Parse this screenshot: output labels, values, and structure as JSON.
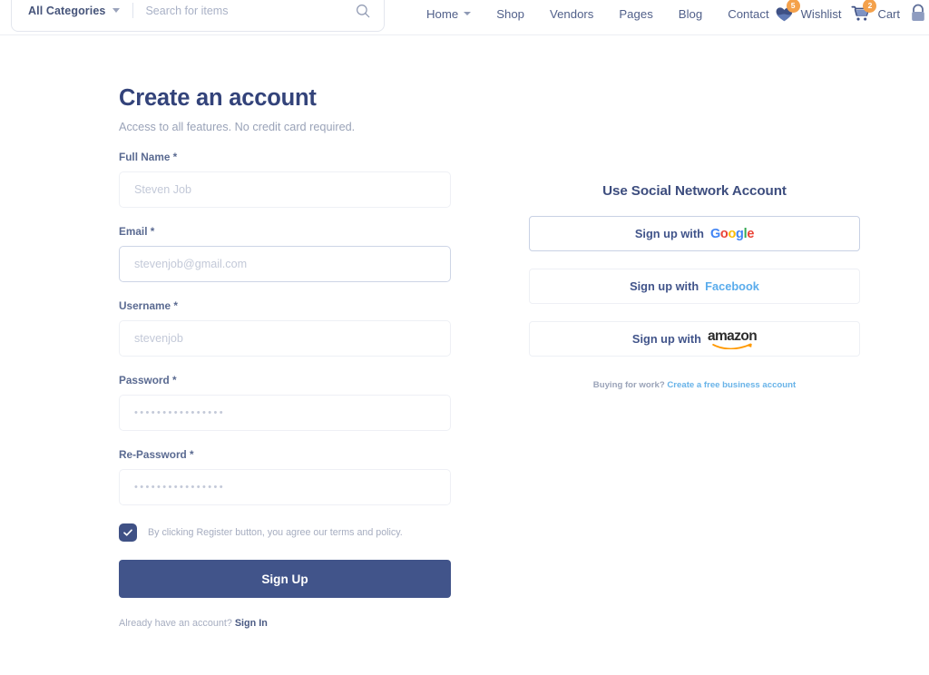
{
  "header": {
    "search": {
      "category_label": "All Categories",
      "category_icon": "chevron-down-icon",
      "placeholder": "Search for items",
      "value": "",
      "search_icon": "search-icon"
    },
    "nav": [
      {
        "label": "Home",
        "has_dropdown": true
      },
      {
        "label": "Shop",
        "has_dropdown": false
      },
      {
        "label": "Vendors",
        "has_dropdown": false
      },
      {
        "label": "Pages",
        "has_dropdown": false
      },
      {
        "label": "Blog",
        "has_dropdown": false
      },
      {
        "label": "Contact",
        "has_dropdown": false
      }
    ],
    "wishlist": {
      "label": "Wishlist",
      "badge": "5",
      "icon": "heart-icon"
    },
    "cart": {
      "label": "Cart",
      "badge": "2",
      "icon": "shopping-cart-icon"
    },
    "account": {
      "icon": "user-account-icon"
    }
  },
  "signup": {
    "title": "Create an account",
    "subtitle": "Access to all features. No credit card required.",
    "fields": [
      {
        "label": "Full Name *",
        "placeholder": "Steven Job",
        "type": "text",
        "focused": false
      },
      {
        "label": "Email *",
        "placeholder": "stevenjob@gmail.com",
        "type": "text",
        "focused": true
      },
      {
        "label": "Username *",
        "placeholder": "stevenjob",
        "type": "text",
        "focused": false
      },
      {
        "label": "Password *",
        "placeholder": "••••••••••••••••",
        "type": "password",
        "focused": false
      },
      {
        "label": "Re-Password *",
        "placeholder": "••••••••••••••••",
        "type": "password",
        "focused": false
      }
    ],
    "terms": {
      "checked": true,
      "checkbox_icon": "checkmark-icon",
      "text": "By clicking Register button, you agree our terms and policy."
    },
    "submit_label": "Sign Up",
    "signin_prefix": "Already have an account?",
    "signin_link": "Sign In"
  },
  "social": {
    "title": "Use Social Network Account",
    "buttons": [
      {
        "prefix": "Sign up with",
        "brand": "Google",
        "brand_icon": "google-logo-icon"
      },
      {
        "prefix": "Sign up with",
        "brand": "Facebook",
        "brand_icon": "facebook-wordmark-icon"
      },
      {
        "prefix": "Sign up with",
        "brand": "amazon",
        "brand_icon": "amazon-logo-icon"
      }
    ],
    "business_prefix": "Buying for work?",
    "business_link": "Create a free business account"
  },
  "colors": {
    "primary": "#41548a",
    "accent_orange": "#f4a14b",
    "link_blue": "#68b3e8",
    "facebook_blue": "#5aacec",
    "google_blue": "#4285f4",
    "google_red": "#ea4335",
    "google_yellow": "#fbbc05",
    "google_green": "#34a853",
    "amazon_orange": "#f90"
  }
}
